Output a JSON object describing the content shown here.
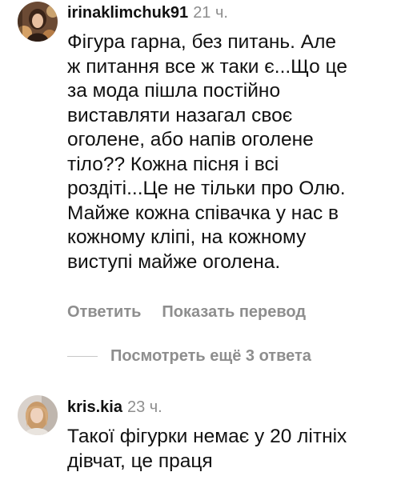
{
  "comments": [
    {
      "username": "irinaklimchuk91",
      "time": "21 ч.",
      "text_lines": [
        "Фігура гарна, без питань. Але",
        "ж питання все ж таки є...Що це",
        "за мода пішла постійно",
        "виставляти назагал своє",
        "оголене, або напів оголене",
        "тіло?? Кожна пісня і всі",
        "роздіті...Це не тільки про Олю.",
        "Майже кожна співачка у нас в",
        "кожному кліпі, на кожному",
        "виступі майже оголена."
      ],
      "reply_label": "Ответить",
      "translate_label": "Показать перевод",
      "view_more_replies": "Посмотреть ещё 3 ответа"
    },
    {
      "username": "kris.kia",
      "time": "23 ч.",
      "text_lines": [
        "Такої фігурки немає у 20 літніх",
        "дівчат, це праця"
      ]
    }
  ]
}
